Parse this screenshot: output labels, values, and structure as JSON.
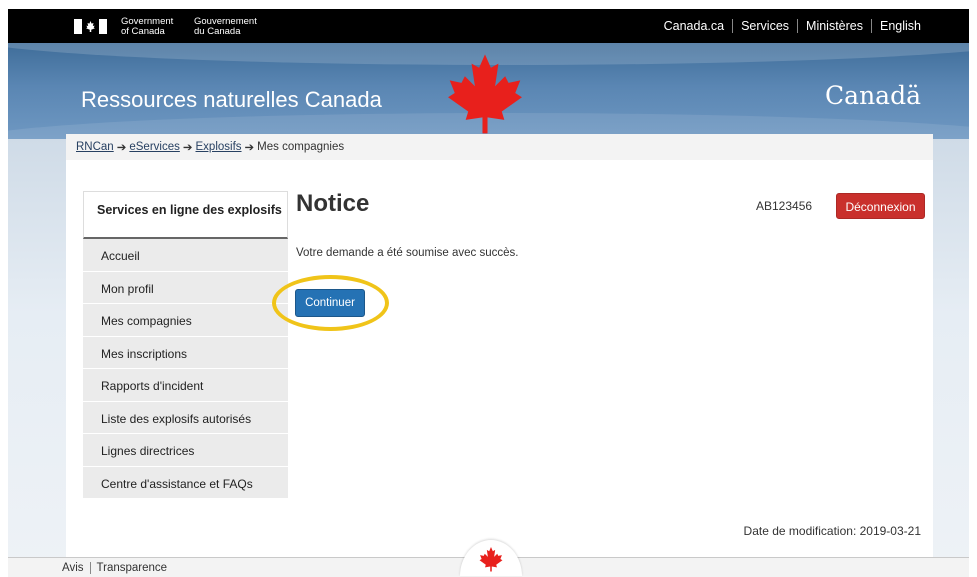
{
  "header": {
    "gov_en_line1": "Government",
    "gov_en_line2": "of Canada",
    "gov_fr_line1": "Gouvernement",
    "gov_fr_line2": "du Canada",
    "links": [
      "Canada.ca",
      "Services",
      "Ministères",
      "English"
    ]
  },
  "banner": {
    "site_title": "Ressources naturelles Canada",
    "wordmark": "Canadä"
  },
  "breadcrumb": {
    "items": [
      "RNCan",
      "eServices",
      "Explosifs"
    ],
    "current": "Mes compagnies",
    "separator": "➔"
  },
  "sidebar": {
    "heading": "Services en ligne des explosifs",
    "items": [
      "Accueil",
      "Mon profil",
      "Mes compagnies",
      "Mes inscriptions",
      "Rapports d'incident",
      "Liste des explosifs autorisés",
      "Lignes directrices",
      "Centre d'assistance et FAQs"
    ]
  },
  "main": {
    "title": "Notice",
    "account_id": "AB123456",
    "logout_label": "Déconnexion",
    "message": "Votre demande a été soumise avec succès.",
    "continue_label": "Continuer",
    "date_modified": "Date de modification: 2019-03-21"
  },
  "footer": {
    "links": [
      "Avis",
      "Transparence"
    ]
  },
  "colors": {
    "logout": "#c9302c",
    "continue": "#2572b4",
    "highlight_ring": "#f0c419",
    "leaf": "#e8201c"
  }
}
